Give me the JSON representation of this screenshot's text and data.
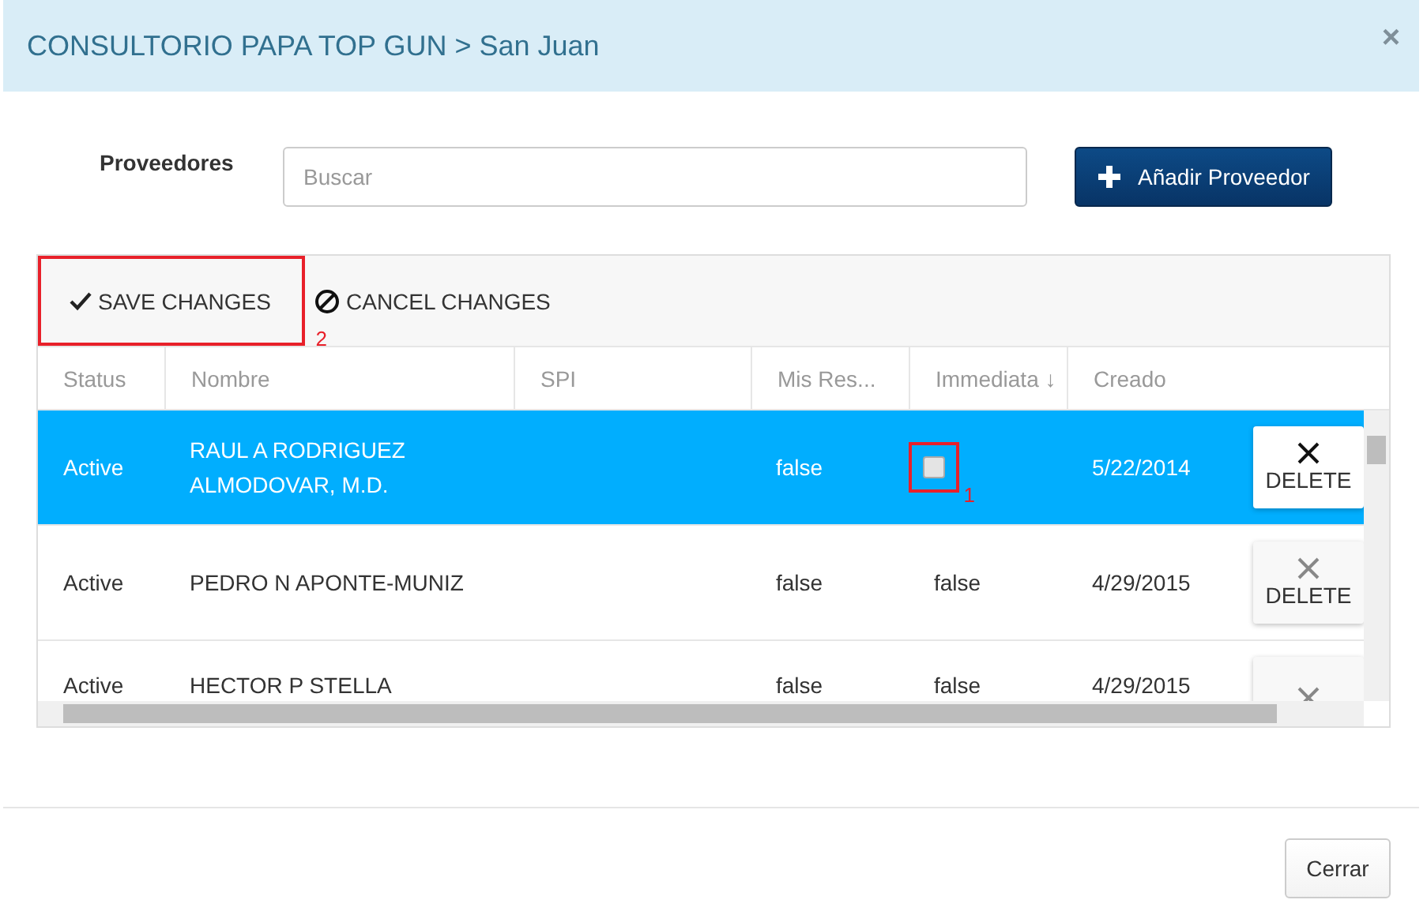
{
  "modal": {
    "title": "CONSULTORIO PAPA TOP GUN > San Juan",
    "close": "×"
  },
  "filter": {
    "label": "Proveedores",
    "search": {
      "placeholder": "Buscar"
    },
    "add_button": "Añadir Proveedor"
  },
  "toolbar": [
    {
      "kind": "save",
      "label": "SAVE CHANGES",
      "callout": "2"
    },
    {
      "kind": "cancel",
      "label": "CANCEL CHANGES"
    }
  ],
  "table": {
    "columns": [
      "Status",
      "Nombre",
      "SPI",
      "Mis Res...",
      "Immediata ↓",
      "Creado"
    ],
    "rows": [
      {
        "selected": true,
        "status": "Active",
        "nombre": "RAUL A RODRIGUEZ ALMODOVAR, M.D.",
        "mis_res": "false",
        "immediata": {
          "kind": "checkbox",
          "checked": false,
          "callout": "1"
        },
        "creado": "5/22/2014",
        "delete": "DELETE"
      },
      {
        "selected": false,
        "status": "Active",
        "nombre": "PEDRO N APONTE-MUNIZ",
        "mis_res": "false",
        "immediata": {
          "kind": "text",
          "text": "false"
        },
        "creado": "4/29/2015",
        "delete": "DELETE"
      },
      {
        "selected": false,
        "status": "Active",
        "nombre": "HECTOR P STELLA",
        "mis_res": "false",
        "immediata": {
          "kind": "text",
          "text": "false"
        },
        "creado": "4/29/2015"
      }
    ]
  },
  "footer": {
    "close_button": "Cerrar"
  }
}
